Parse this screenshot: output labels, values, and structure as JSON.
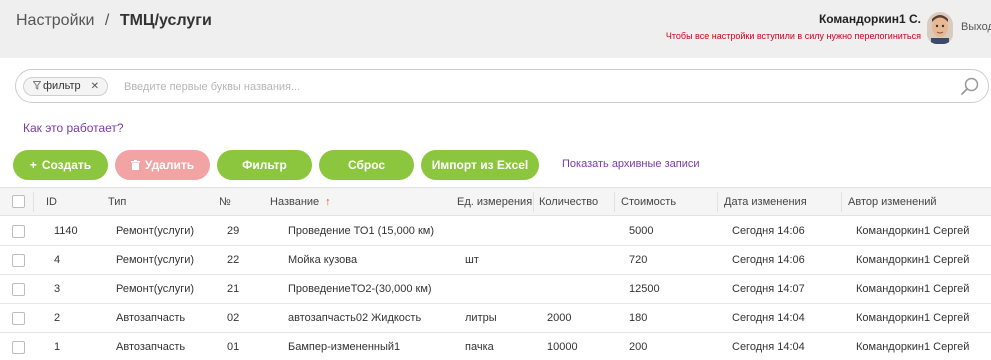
{
  "header": {
    "breadcrumb_root": "Настройки",
    "breadcrumb_sep": "/",
    "breadcrumb_current": "ТМЦ/услуги",
    "user_name": "Командоркин1 С.",
    "relogin_note": "Чтобы все настройки вступили в силу нужно перелогиниться",
    "logout_label": "Выход"
  },
  "search": {
    "filter_chip_label": "фильтр",
    "filter_chip_close": "✕",
    "placeholder": "Введите первые буквы названия..."
  },
  "help_link": "Как это работает?",
  "toolbar": {
    "create_label": "Создать",
    "delete_label": "Удалить",
    "filter_label": "Фильтр",
    "reset_label": "Сброс",
    "import_label": "Импорт из Excel",
    "archive_link": "Показать архивные записи"
  },
  "icons": {
    "filter_chip": "funnel-icon",
    "search": "magnifier-icon",
    "create": "plus-icon",
    "delete": "trash-icon",
    "sort": "arrow-up-icon"
  },
  "colors": {
    "accent_green": "#8cc63f",
    "delete_disabled": "#f2a3a3",
    "link_purple": "#7a3aa6",
    "warning_red": "#d0021b",
    "sort_arrow": "#e8501e"
  },
  "table": {
    "sort_arrow": "↑",
    "columns": {
      "id": "ID",
      "type": "Тип",
      "num": "№",
      "name": "Название",
      "unit": "Ед. измерения",
      "qty": "Количество",
      "cost": "Стоимость",
      "changed": "Дата изменения",
      "author": "Автор изменений"
    },
    "rows": [
      {
        "id": "1140",
        "type": "Ремонт(услуги)",
        "num": "29",
        "name": "Проведение ТО1 (15,000 км)",
        "unit": "",
        "qty": "",
        "cost": "5000",
        "changed": "Сегодня 14:06",
        "author": "Командоркин1 Сергей"
      },
      {
        "id": "4",
        "type": "Ремонт(услуги)",
        "num": "22",
        "name": "Мойка кузова",
        "unit": "шт",
        "qty": "",
        "cost": "720",
        "changed": "Сегодня 14:06",
        "author": "Командоркин1 Сергей"
      },
      {
        "id": "3",
        "type": "Ремонт(услуги)",
        "num": "21",
        "name": "ПроведениеТО2-(30,000 км)",
        "unit": "",
        "qty": "",
        "cost": "12500",
        "changed": "Сегодня 14:07",
        "author": "Командоркин1 Сергей"
      },
      {
        "id": "2",
        "type": "Автозапчасть",
        "num": "02",
        "name": "автозапчасть02 Жидкость",
        "unit": "литры",
        "qty": "2000",
        "cost": "180",
        "changed": "Сегодня 14:04",
        "author": "Командоркин1 Сергей"
      },
      {
        "id": "1",
        "type": "Автозапчасть",
        "num": "01",
        "name": "Бампер-измененный1",
        "unit": "пачка",
        "qty": "10000",
        "cost": "200",
        "changed": "Сегодня 14:04",
        "author": "Командоркин1 Сергей"
      }
    ]
  }
}
